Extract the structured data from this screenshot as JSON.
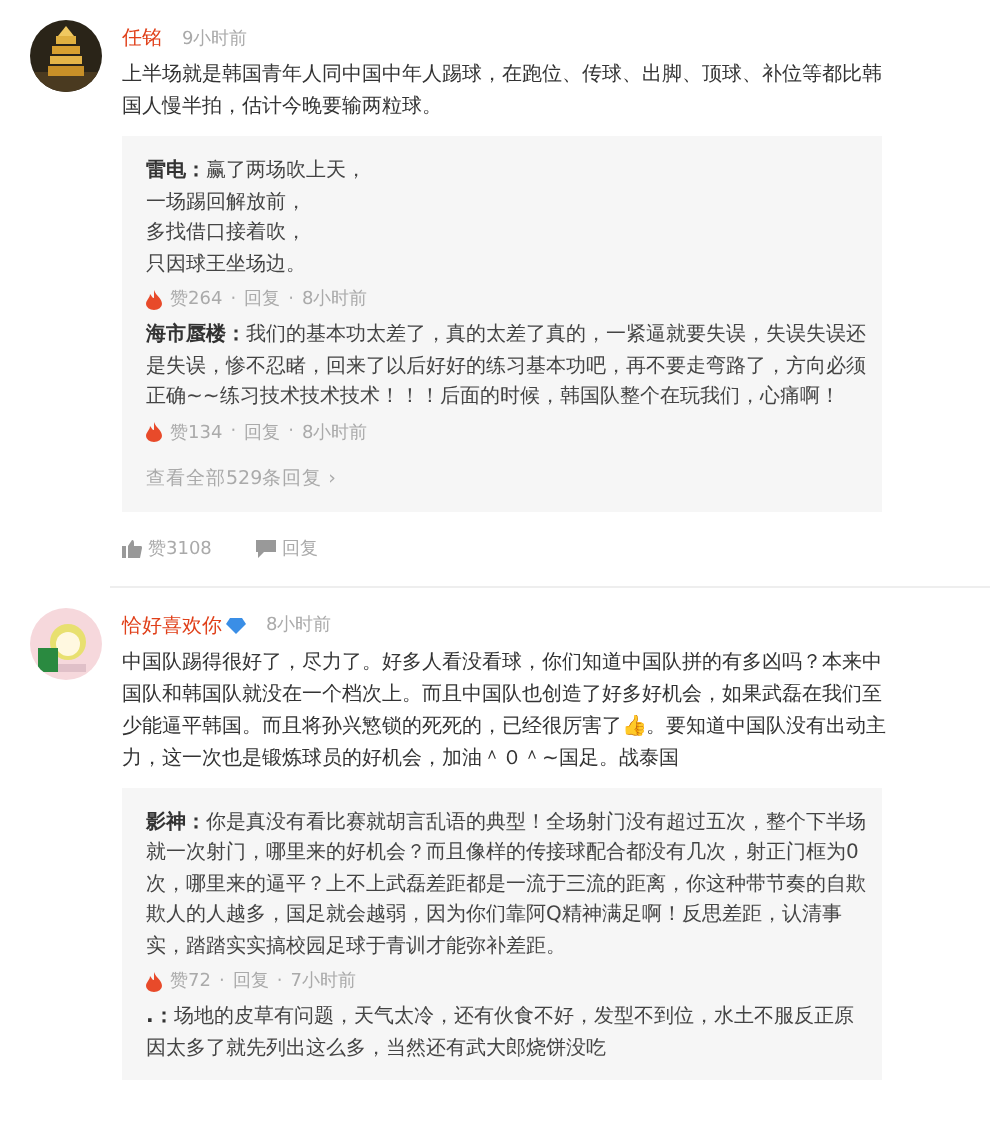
{
  "separator": "·",
  "comments": [
    {
      "user": "任铭",
      "verified": false,
      "time": "9小时前",
      "text": "上半场就是韩国青年人同中国中年人踢球，在跑位、传球、出脚、顶球、补位等都比韩国人慢半拍，估计今晚要输两粒球。",
      "replies": [
        {
          "user": "雷电：",
          "lines": [
            "赢了两场吹上天，",
            "一场踢回解放前，",
            "多找借口接着吹，",
            "只因球王坐场边。"
          ],
          "likes": "赞264",
          "reply": "回复",
          "time": "8小时前"
        },
        {
          "user": "海市蜃楼：",
          "text": "我们的基本功太差了，真的太差了真的，一紧逼就要失误，失误失误还是失误，惨不忍睹，回来了以后好好的练习基本功吧，再不要走弯路了，方向必须正确~~练习技术技术技术！！！后面的时候，韩国队整个在玩我们，心痛啊！",
          "likes": "赞134",
          "reply": "回复",
          "time": "8小时前"
        }
      ],
      "more_replies": "查看全部529条回复 ›",
      "likes": "赞3108",
      "reply": "回复"
    },
    {
      "user": "恰好喜欢你",
      "verified": true,
      "time": "8小时前",
      "text": "中国队踢得很好了，尽力了。好多人看没看球，你们知道中国队拼的有多凶吗？本来中国队和韩国队就没在一个档次上。而且中国队也创造了好多好机会，如果武磊在我们至少能逼平韩国。而且将孙兴慜锁的死死的，已经很厉害了👍。要知道中国队没有出动主力，这一次也是锻炼球员的好机会，加油＾０＾~国足。战泰国",
      "replies": [
        {
          "user": "影神：",
          "text": "你是真没有看比赛就胡言乱语的典型！全场射门没有超过五次，整个下半场就一次射门，哪里来的好机会？而且像样的传接球配合都没有几次，射正门框为0次，哪里来的逼平？上不上武磊差距都是一流于三流的距离，你这种带节奏的自欺欺人的人越多，国足就会越弱，因为你们靠阿Q精神满足啊！反思差距，认清事实，踏踏实实搞校园足球于青训才能弥补差距。",
          "likes": "赞72",
          "reply": "回复",
          "time": "7小时前"
        },
        {
          "user": ".：",
          "text": "场地的皮草有问题，天气太冷，还有伙食不好，发型不到位，水土不服反正原因太多了就先列出这么多，当然还有武大郎烧饼没吃"
        }
      ]
    }
  ]
}
